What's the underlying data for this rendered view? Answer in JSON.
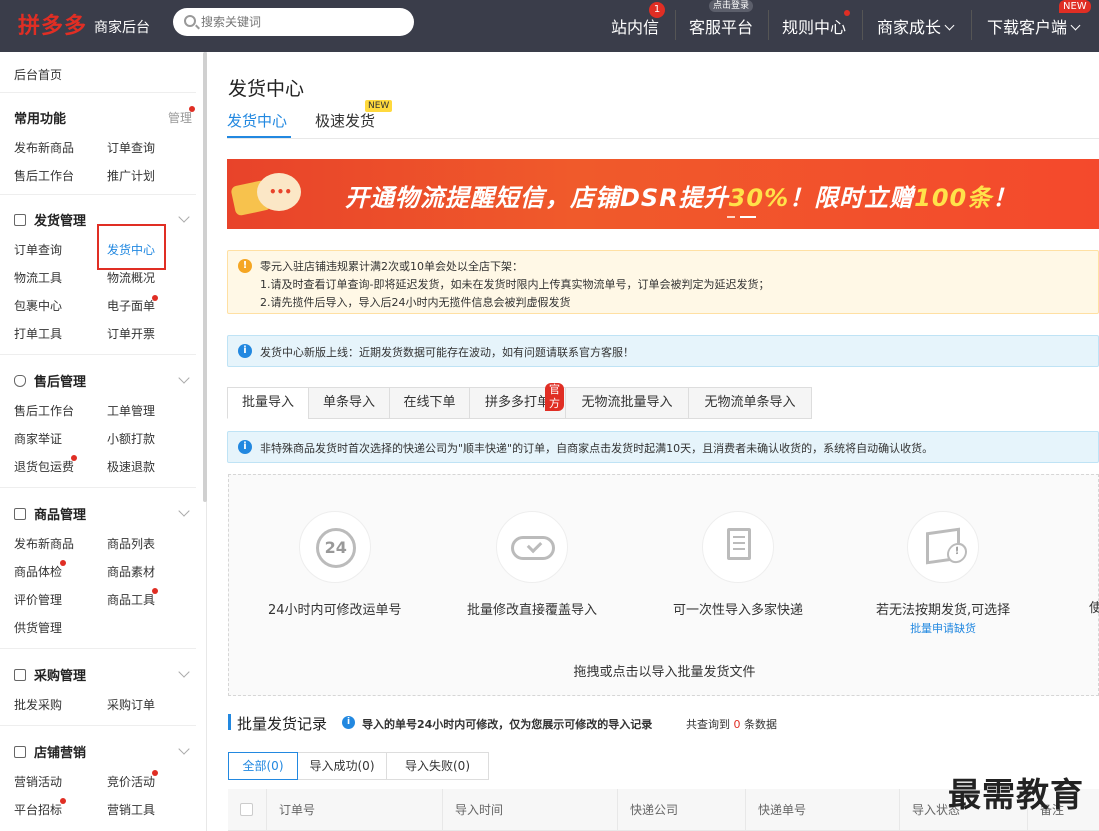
{
  "header": {
    "logo": "拼多多",
    "subtitle": "商家后台",
    "search_placeholder": "搜索关键词",
    "nav": [
      {
        "label": "站内信",
        "badge": "1"
      },
      {
        "label": "客服平台",
        "tag": "点击登录"
      },
      {
        "label": "规则中心"
      },
      {
        "label": "商家成长"
      },
      {
        "label": "下载客户端",
        "tag": "NEW"
      }
    ]
  },
  "sidebar": {
    "home": "后台首页",
    "common": {
      "title": "常用功能",
      "manage": "管理",
      "items": [
        "发布新商品",
        "订单查询",
        "售后工作台",
        "推广计划"
      ]
    },
    "shipping": {
      "title": "发货管理",
      "items": [
        "订单查询",
        "发货中心",
        "物流工具",
        "物流概况",
        "包裹中心",
        "电子面单",
        "打单工具",
        "订单开票"
      ]
    },
    "aftersale": {
      "title": "售后管理",
      "items": [
        "售后工作台",
        "工单管理",
        "商家举证",
        "小额打款",
        "退货包运费",
        "极速退款"
      ]
    },
    "goods": {
      "title": "商品管理",
      "items": [
        "发布新商品",
        "商品列表",
        "商品体检",
        "商品素材",
        "评价管理",
        "商品工具",
        "供货管理"
      ]
    },
    "purchase": {
      "title": "采购管理",
      "items": [
        "批发采购",
        "采购订单"
      ]
    },
    "marketing": {
      "title": "店铺营销",
      "items": [
        "营销活动",
        "竞价活动",
        "平台招标",
        "营销工具"
      ]
    }
  },
  "main": {
    "title": "发货中心",
    "tabs": [
      "发货中心",
      "极速发货"
    ],
    "tab_new": "NEW",
    "banner": {
      "part1": "开通物流提醒短信，店铺DSR提升",
      "highlight1": "30%",
      "part2": "！限时立赠",
      "highlight2": "100条",
      "part3": "！"
    },
    "warning": {
      "line1": "零元入驻店铺违规累计满2次或10单会处以全店下架：",
      "line2": "1.请及时查看订单查询-即将延迟发货，如未在发货时限内上传真实物流单号，订单会被判定为延迟发货；",
      "line3": "2.请先揽件后导入，导入后24小时内无揽件信息会被判虚假发货"
    },
    "info": "发货中心新版上线：近期发货数据可能存在波动，如有问题请联系官方客服！",
    "import_tabs": [
      "批量导入",
      "单条导入",
      "在线下单",
      "拼多多打单",
      "无物流批量导入",
      "无物流单条导入"
    ],
    "import_badge": "官方",
    "info2": "非特殊商品发货时首次选择的快递公司为\"顺丰快递\"的订单，自商家点击发货时起满10天，且消费者未确认收货的，系统将自动确认收货。",
    "features": [
      {
        "icon": "24",
        "label": "24小时内可修改运单号"
      },
      {
        "label": "批量修改直接覆盖导入"
      },
      {
        "label": "可一次性导入多家快递"
      },
      {
        "label": "若无法按期发货,可选择",
        "sub": "批量申请缺货"
      },
      {
        "label": "使"
      }
    ],
    "drop_text": "拖拽或点击以导入批量发货文件",
    "records": {
      "title": "批量发货记录",
      "tip": "导入的单号24小时内可修改，仅为您展示可修改的导入记录",
      "count_prefix": "共查询到",
      "count": "0",
      "count_suffix": "条数据",
      "filters": [
        "全部(0)",
        "导入成功(0)",
        "导入失败(0)"
      ],
      "columns": [
        "订单号",
        "导入时间",
        "快递公司",
        "快递单号",
        "导入状态",
        "备注"
      ]
    }
  },
  "watermark": "最需教育"
}
